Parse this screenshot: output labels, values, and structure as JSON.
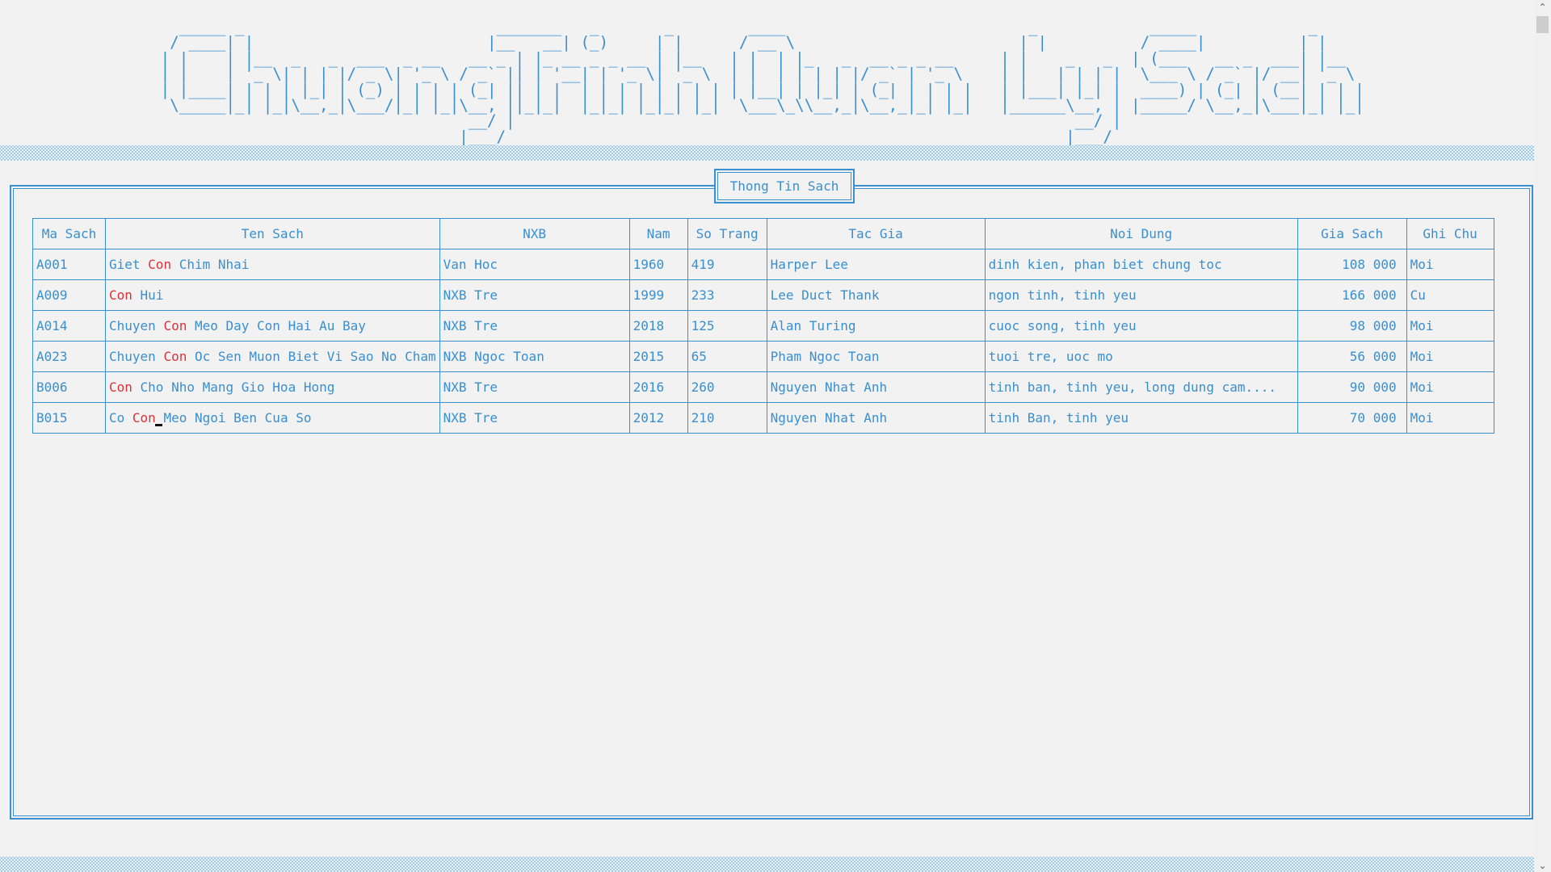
{
  "banner": {
    "ascii_art": "  _____ _                           _______   _       _        ____                          _            _____            _      \n / ____| |                         |__   __| (_)     | |      / __ \\                        | |          / ____|          | |     \n| |    | |__  _   _  ___  _ __   __ _ | |_ __ _ _ __ | |__   | |  | |_   _  __ _ _ __     | |    _   _  | (___   __ _  ___| |__   \n| |    | '_ \\| | | |/ _ \\| '_ \\ / _` || | '__| | '_ \\| '_ \\  | |  | | | | |/ _` | '_ \\    | |   | | | |  \\___ \\ / _` |/ __| '_ \\  \n| |____| | | | |_| | (_) | | | | (_| || | |  | | | | | | | | | |__| | |_| | (_| | | | |   | |___| |_| |  ____) | (_| | (__| | | | \n \\_____|_| |_|\\__,_|\\___/|_| |_|\\__, ||_|_|  |_|_| |_|_| |_|  \\___\\_\\\\__,_|\\__,_|_| |_|   |______\\__, | |_____/ \\__,_|\\___|_| |_| \n                                 __/ |                                                            __/ |                           \n                                |___/                                                            |___/                            "
  },
  "panel": {
    "title": "Thong Tin Sach"
  },
  "table": {
    "headers": [
      "Ma Sach",
      "Ten Sach",
      "NXB",
      "Nam",
      "So Trang",
      "Tac Gia",
      "Noi Dung",
      "Gia Sach",
      "Ghi Chu"
    ],
    "search_highlight": "Con",
    "rows": [
      {
        "ma": "A001",
        "ten": [
          "Giet ",
          "Con",
          " Chim Nhai"
        ],
        "nxb": "Van Hoc",
        "nam": "1960",
        "trang": "419",
        "tacgia": "Harper Lee",
        "noidung": "dinh kien, phan biet chung toc",
        "gia": "108 000",
        "ghichu": "Moi"
      },
      {
        "ma": "A009",
        "ten": [
          "",
          "Con",
          " Hui"
        ],
        "nxb": "NXB Tre",
        "nam": "1999",
        "trang": "233",
        "tacgia": "Lee Duct Thank",
        "noidung": "ngon tinh, tinh yeu",
        "gia": "166 000",
        "ghichu": "Cu"
      },
      {
        "ma": "A014",
        "ten": [
          "Chuyen ",
          "Con",
          " Meo Day Con Hai Au Bay"
        ],
        "nxb": "NXB Tre",
        "nam": "2018",
        "trang": "125",
        "tacgia": "Alan Turing",
        "noidung": "cuoc song, tinh yeu",
        "gia": "98 000",
        "ghichu": "Moi"
      },
      {
        "ma": "A023",
        "ten": [
          "Chuyen ",
          "Con",
          " Oc Sen Muon Biet Vi Sao No Cham"
        ],
        "nxb": "NXB Ngoc Toan",
        "nam": "2015",
        "trang": "65",
        "tacgia": "Pham Ngoc Toan",
        "noidung": "tuoi tre, uoc mo",
        "gia": "56 000",
        "ghichu": "Moi"
      },
      {
        "ma": "B006",
        "ten": [
          "",
          "Con",
          " Cho Nho Mang Gio Hoa Hong"
        ],
        "nxb": "NXB Tre",
        "nam": "2016",
        "trang": "260",
        "tacgia": "Nguyen Nhat Anh",
        "noidung": "tinh ban, tinh yeu, long dung cam....",
        "gia": "90 000",
        "ghichu": "Moi"
      },
      {
        "ma": "B015",
        "ten": [
          "Co ",
          "Con",
          " Meo Ngoi Ben Cua So"
        ],
        "nxb": "NXB Tre",
        "nam": "2012",
        "trang": "210",
        "tacgia": "Nguyen Nhat Anh",
        "noidung": "tinh Ban, tinh yeu",
        "gia": "70 000",
        "ghichu": "Moi"
      }
    ]
  },
  "scrollbar": {
    "up_icon": "chevron-up-icon",
    "down_icon": "chevron-down-icon"
  },
  "colors": {
    "text": "#3a8fd0",
    "highlight": "#e0303a",
    "background": "#f2f2f2"
  }
}
